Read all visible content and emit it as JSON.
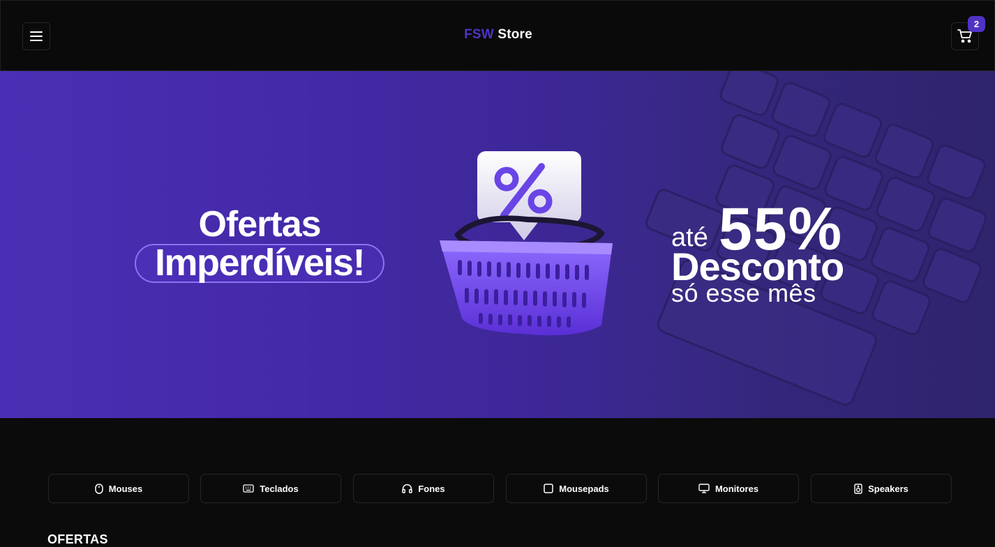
{
  "header": {
    "brand_accent": "FSW",
    "brand_rest": " Store",
    "cart_count": "2",
    "menu_icon": "hamburger-menu-icon",
    "cart_icon": "shopping-cart-icon"
  },
  "banner": {
    "headline_line1": "Ofertas",
    "headline_line2": "Imperdíveis!",
    "discount_prefix": "até",
    "discount_value": "55%",
    "discount_label": "Desconto",
    "discount_sub": "só esse mês"
  },
  "categories": [
    {
      "label": "Mouses",
      "icon": "mouse-icon"
    },
    {
      "label": "Teclados",
      "icon": "keyboard-icon"
    },
    {
      "label": "Fones",
      "icon": "headphones-icon"
    },
    {
      "label": "Mousepads",
      "icon": "square-icon"
    },
    {
      "label": "Monitores",
      "icon": "monitor-icon"
    },
    {
      "label": "Speakers",
      "icon": "speaker-icon"
    }
  ],
  "sections": {
    "offers_title": "OFERTAS"
  },
  "colors": {
    "accent": "#5033c3",
    "background": "#0b0b0b",
    "border": "#262626"
  }
}
